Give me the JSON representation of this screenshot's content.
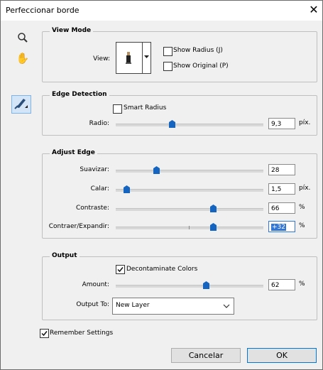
{
  "window": {
    "title": "Perfeccionar borde"
  },
  "view_mode": {
    "title": "View Mode",
    "view_label": "View:",
    "show_radius": "Show Radius (J)",
    "show_original": "Show Original (P)"
  },
  "edge_detection": {
    "title": "Edge Detection",
    "smart_radius": "Smart Radius",
    "radius_label": "Radio:",
    "radius_value": "9,3",
    "radius_unit": "píx."
  },
  "adjust_edge": {
    "title": "Adjust Edge",
    "smooth_label": "Suavizar:",
    "smooth_value": "28",
    "feather_label": "Calar:",
    "feather_value": "1,5",
    "feather_unit": "píx.",
    "contrast_label": "Contraste:",
    "contrast_value": "66",
    "contrast_unit": "%",
    "shift_label": "Contraer/Expandir:",
    "shift_value": "+32",
    "shift_unit": "%"
  },
  "output": {
    "title": "Output",
    "decontaminate": "Decontaminate Colors",
    "amount_label": "Amount:",
    "amount_value": "62",
    "amount_unit": "%",
    "output_to_label": "Output To:",
    "output_to_value": "New Layer"
  },
  "footer": {
    "remember": "Remember Settings",
    "cancel": "Cancelar",
    "ok": "OK"
  }
}
